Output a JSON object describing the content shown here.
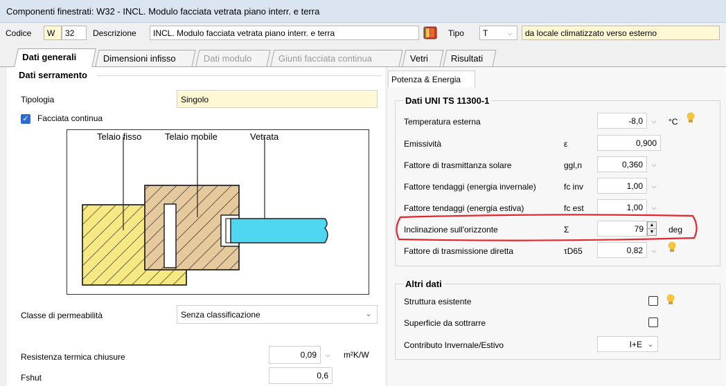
{
  "window": {
    "title": "Componenti finestrati: W32 - INCL. Modulo facciata vetrata piano interr. e terra"
  },
  "toolbar": {
    "codice_label": "Codice",
    "codice_prefix": "W",
    "codice_number": "32",
    "descrizione_label": "Descrizione",
    "descrizione_value": "INCL. Modulo facciata vetrata piano interr. e terra",
    "tipo_label": "Tipo",
    "tipo_value": "T",
    "tipo_description": "da locale climatizzato verso esterno"
  },
  "tabs": [
    {
      "label": "Dati generali"
    },
    {
      "label": "Dimensioni infisso"
    },
    {
      "label": "Dati modulo"
    },
    {
      "label": "Giunti facciata continua"
    },
    {
      "label": "Vetri"
    },
    {
      "label": "Risultati"
    }
  ],
  "left": {
    "section_title": "Dati serramento",
    "tipologia_label": "Tipologia",
    "tipologia_value": "Singolo",
    "facciata_label": "Facciata continua",
    "diagram": {
      "label_fisso": "Telaio fisso",
      "label_mobile": "Telaio mobile",
      "label_vetrata": "Vetrata"
    },
    "classe_label": "Classe di permeabilità",
    "classe_value": "Senza classificazione",
    "resistenza_label": "Resistenza termica chiusure",
    "resistenza_value": "0,09",
    "resistenza_unit": "m²K/W",
    "fshut_label": "Fshut",
    "fshut_value": "0,6"
  },
  "right": {
    "subtab": "Potenza & Energia",
    "group1_title": "Dati UNI TS 11300-1",
    "rows": [
      {
        "label": "Temperatura esterna",
        "symbol": "",
        "value": "-8,0",
        "unit": "°C"
      },
      {
        "label": "Emissività",
        "symbol": "ε",
        "value": "0,900",
        "unit": ""
      },
      {
        "label": "Fattore di trasmittanza solare",
        "symbol": "ggl,n",
        "value": "0,360",
        "unit": ""
      },
      {
        "label": "Fattore tendaggi (energia invernale)",
        "symbol": "fc inv",
        "value": "1,00",
        "unit": ""
      },
      {
        "label": "Fattore tendaggi (energia estiva)",
        "symbol": "fc est",
        "value": "1,00",
        "unit": ""
      },
      {
        "label": "Inclinazione sull'orizzonte",
        "symbol": "Σ",
        "value": "79",
        "unit": "deg"
      },
      {
        "label": "Fattore di trasmissione diretta",
        "symbol": "τD65",
        "value": "0,82",
        "unit": ""
      }
    ],
    "group2_title": "Altri dati",
    "struttura_label": "Struttura esistente",
    "superficie_label": "Superficie da sottrarre",
    "contributo_label": "Contributo Invernale/Estivo",
    "contributo_value": "I+E"
  },
  "colors": {
    "highlight": "#e0262e",
    "check": "#2b6cd4",
    "glass": "#48d8f0",
    "wood": "#f3e27a"
  }
}
